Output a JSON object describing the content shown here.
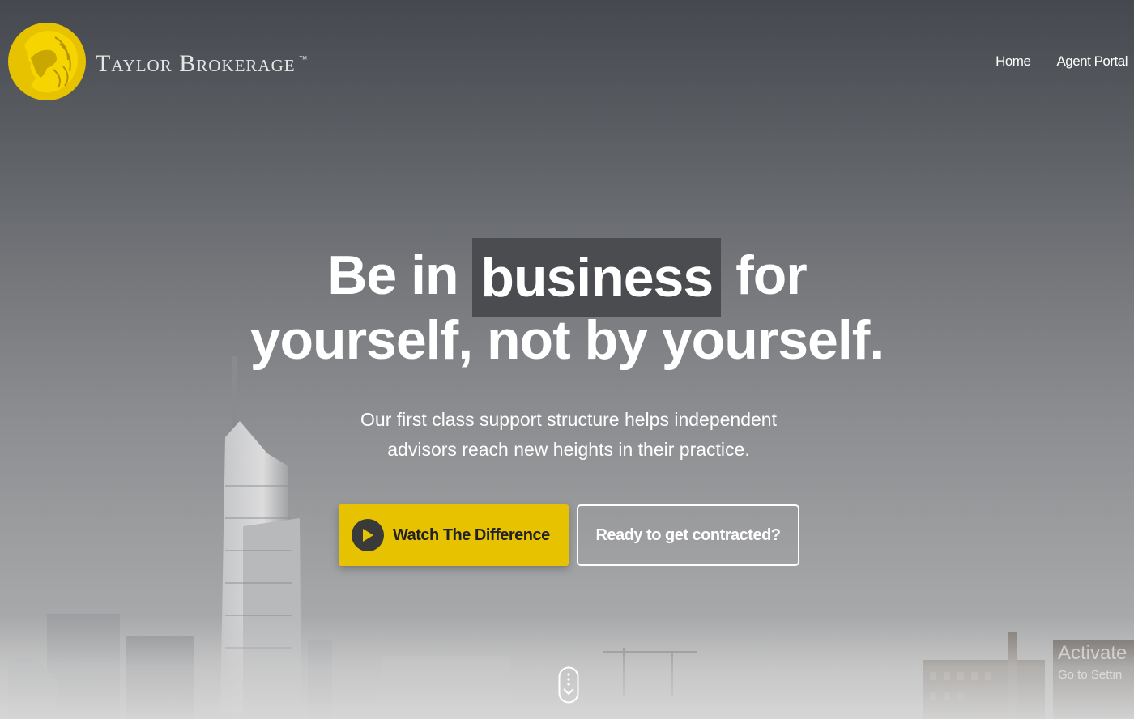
{
  "header": {
    "brand_name": "Taylor Brokerage",
    "trademark": "™",
    "nav": [
      {
        "label": "Home"
      },
      {
        "label": "Agent Portal"
      }
    ]
  },
  "hero": {
    "headline_before": "Be in",
    "headline_highlight": "business",
    "headline_after": "for",
    "headline_line2": "yourself, not by yourself.",
    "subtext_line1": "Our first class support structure helps independent",
    "subtext_line2": "advisors reach new heights in their practice.",
    "primary_button": {
      "label": "Watch The Difference",
      "icon": "play-icon"
    },
    "secondary_button": {
      "label": "Ready to get contracted?"
    },
    "scroll_icon": "scroll-down-icon"
  },
  "watermark": {
    "line1": "Activate",
    "line2": "Go to Settin"
  },
  "colors": {
    "accent": "#e6c200",
    "highlight_bg": "#4a4c4f",
    "text_light": "#ffffff"
  }
}
